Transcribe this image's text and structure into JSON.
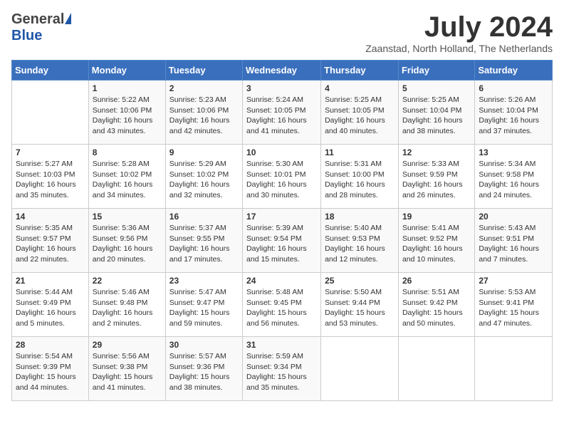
{
  "header": {
    "logo_general": "General",
    "logo_blue": "Blue",
    "month_title": "July 2024",
    "location": "Zaanstad, North Holland, The Netherlands"
  },
  "days_of_week": [
    "Sunday",
    "Monday",
    "Tuesday",
    "Wednesday",
    "Thursday",
    "Friday",
    "Saturday"
  ],
  "weeks": [
    [
      {
        "day": "",
        "content": ""
      },
      {
        "day": "1",
        "content": "Sunrise: 5:22 AM\nSunset: 10:06 PM\nDaylight: 16 hours\nand 43 minutes."
      },
      {
        "day": "2",
        "content": "Sunrise: 5:23 AM\nSunset: 10:06 PM\nDaylight: 16 hours\nand 42 minutes."
      },
      {
        "day": "3",
        "content": "Sunrise: 5:24 AM\nSunset: 10:05 PM\nDaylight: 16 hours\nand 41 minutes."
      },
      {
        "day": "4",
        "content": "Sunrise: 5:25 AM\nSunset: 10:05 PM\nDaylight: 16 hours\nand 40 minutes."
      },
      {
        "day": "5",
        "content": "Sunrise: 5:25 AM\nSunset: 10:04 PM\nDaylight: 16 hours\nand 38 minutes."
      },
      {
        "day": "6",
        "content": "Sunrise: 5:26 AM\nSunset: 10:04 PM\nDaylight: 16 hours\nand 37 minutes."
      }
    ],
    [
      {
        "day": "7",
        "content": "Sunrise: 5:27 AM\nSunset: 10:03 PM\nDaylight: 16 hours\nand 35 minutes."
      },
      {
        "day": "8",
        "content": "Sunrise: 5:28 AM\nSunset: 10:02 PM\nDaylight: 16 hours\nand 34 minutes."
      },
      {
        "day": "9",
        "content": "Sunrise: 5:29 AM\nSunset: 10:02 PM\nDaylight: 16 hours\nand 32 minutes."
      },
      {
        "day": "10",
        "content": "Sunrise: 5:30 AM\nSunset: 10:01 PM\nDaylight: 16 hours\nand 30 minutes."
      },
      {
        "day": "11",
        "content": "Sunrise: 5:31 AM\nSunset: 10:00 PM\nDaylight: 16 hours\nand 28 minutes."
      },
      {
        "day": "12",
        "content": "Sunrise: 5:33 AM\nSunset: 9:59 PM\nDaylight: 16 hours\nand 26 minutes."
      },
      {
        "day": "13",
        "content": "Sunrise: 5:34 AM\nSunset: 9:58 PM\nDaylight: 16 hours\nand 24 minutes."
      }
    ],
    [
      {
        "day": "14",
        "content": "Sunrise: 5:35 AM\nSunset: 9:57 PM\nDaylight: 16 hours\nand 22 minutes."
      },
      {
        "day": "15",
        "content": "Sunrise: 5:36 AM\nSunset: 9:56 PM\nDaylight: 16 hours\nand 20 minutes."
      },
      {
        "day": "16",
        "content": "Sunrise: 5:37 AM\nSunset: 9:55 PM\nDaylight: 16 hours\nand 17 minutes."
      },
      {
        "day": "17",
        "content": "Sunrise: 5:39 AM\nSunset: 9:54 PM\nDaylight: 16 hours\nand 15 minutes."
      },
      {
        "day": "18",
        "content": "Sunrise: 5:40 AM\nSunset: 9:53 PM\nDaylight: 16 hours\nand 12 minutes."
      },
      {
        "day": "19",
        "content": "Sunrise: 5:41 AM\nSunset: 9:52 PM\nDaylight: 16 hours\nand 10 minutes."
      },
      {
        "day": "20",
        "content": "Sunrise: 5:43 AM\nSunset: 9:51 PM\nDaylight: 16 hours\nand 7 minutes."
      }
    ],
    [
      {
        "day": "21",
        "content": "Sunrise: 5:44 AM\nSunset: 9:49 PM\nDaylight: 16 hours\nand 5 minutes."
      },
      {
        "day": "22",
        "content": "Sunrise: 5:46 AM\nSunset: 9:48 PM\nDaylight: 16 hours\nand 2 minutes."
      },
      {
        "day": "23",
        "content": "Sunrise: 5:47 AM\nSunset: 9:47 PM\nDaylight: 15 hours\nand 59 minutes."
      },
      {
        "day": "24",
        "content": "Sunrise: 5:48 AM\nSunset: 9:45 PM\nDaylight: 15 hours\nand 56 minutes."
      },
      {
        "day": "25",
        "content": "Sunrise: 5:50 AM\nSunset: 9:44 PM\nDaylight: 15 hours\nand 53 minutes."
      },
      {
        "day": "26",
        "content": "Sunrise: 5:51 AM\nSunset: 9:42 PM\nDaylight: 15 hours\nand 50 minutes."
      },
      {
        "day": "27",
        "content": "Sunrise: 5:53 AM\nSunset: 9:41 PM\nDaylight: 15 hours\nand 47 minutes."
      }
    ],
    [
      {
        "day": "28",
        "content": "Sunrise: 5:54 AM\nSunset: 9:39 PM\nDaylight: 15 hours\nand 44 minutes."
      },
      {
        "day": "29",
        "content": "Sunrise: 5:56 AM\nSunset: 9:38 PM\nDaylight: 15 hours\nand 41 minutes."
      },
      {
        "day": "30",
        "content": "Sunrise: 5:57 AM\nSunset: 9:36 PM\nDaylight: 15 hours\nand 38 minutes."
      },
      {
        "day": "31",
        "content": "Sunrise: 5:59 AM\nSunset: 9:34 PM\nDaylight: 15 hours\nand 35 minutes."
      },
      {
        "day": "",
        "content": ""
      },
      {
        "day": "",
        "content": ""
      },
      {
        "day": "",
        "content": ""
      }
    ]
  ]
}
